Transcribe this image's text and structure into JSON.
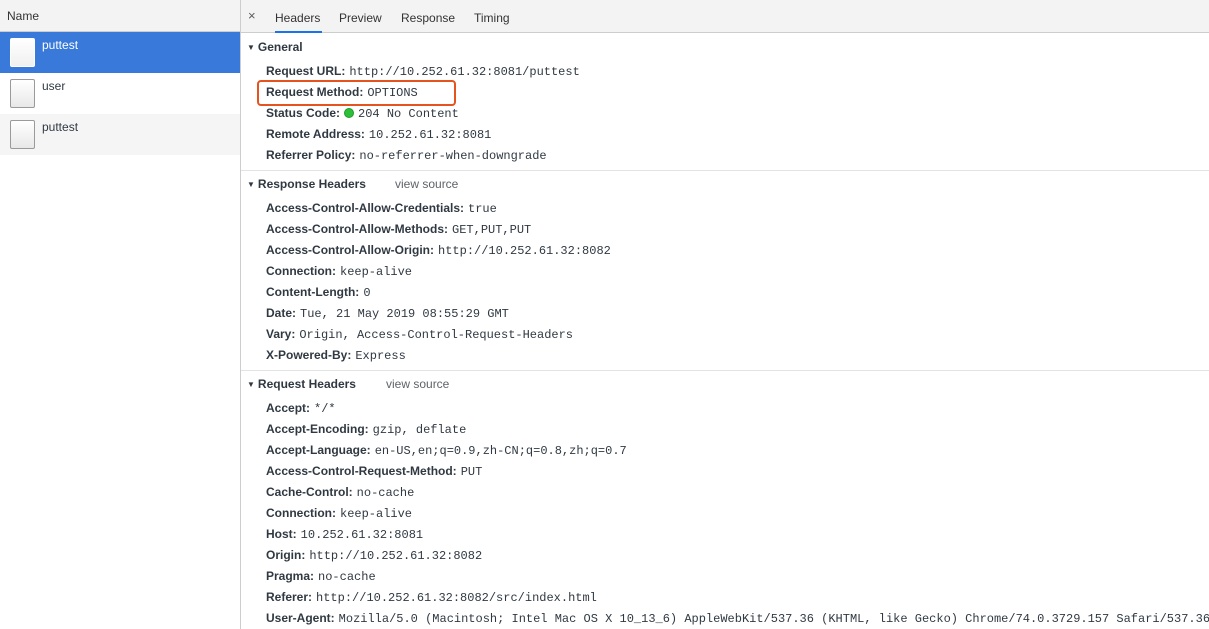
{
  "left_panel": {
    "header": "Name",
    "requests": [
      {
        "name": "puttest"
      },
      {
        "name": "user"
      },
      {
        "name": "puttest"
      }
    ]
  },
  "tabs": {
    "close": "×",
    "items": [
      "Headers",
      "Preview",
      "Response",
      "Timing"
    ],
    "active": "Headers"
  },
  "general": {
    "title": "General",
    "rows": [
      {
        "key": "Request URL:",
        "value": "http://10.252.61.32:8081/puttest"
      },
      {
        "key": "Request Method:",
        "value": "OPTIONS"
      },
      {
        "key": "Status Code:",
        "value": "204 No Content"
      },
      {
        "key": "Remote Address:",
        "value": "10.252.61.32:8081"
      },
      {
        "key": "Referrer Policy:",
        "value": "no-referrer-when-downgrade"
      }
    ]
  },
  "response_headers": {
    "title": "Response Headers",
    "view_source": "view source",
    "rows": [
      {
        "key": "Access-Control-Allow-Credentials:",
        "value": "true"
      },
      {
        "key": "Access-Control-Allow-Methods:",
        "value": "GET,PUT,PUT"
      },
      {
        "key": "Access-Control-Allow-Origin:",
        "value": "http://10.252.61.32:8082"
      },
      {
        "key": "Connection:",
        "value": "keep-alive"
      },
      {
        "key": "Content-Length:",
        "value": "0"
      },
      {
        "key": "Date:",
        "value": "Tue, 21 May 2019 08:55:29 GMT"
      },
      {
        "key": "Vary:",
        "value": "Origin, Access-Control-Request-Headers"
      },
      {
        "key": "X-Powered-By:",
        "value": "Express"
      }
    ]
  },
  "request_headers": {
    "title": "Request Headers",
    "view_source": "view source",
    "rows": [
      {
        "key": "Accept:",
        "value": "*/*"
      },
      {
        "key": "Accept-Encoding:",
        "value": "gzip, deflate"
      },
      {
        "key": "Accept-Language:",
        "value": "en-US,en;q=0.9,zh-CN;q=0.8,zh;q=0.7"
      },
      {
        "key": "Access-Control-Request-Method:",
        "value": "PUT"
      },
      {
        "key": "Cache-Control:",
        "value": "no-cache"
      },
      {
        "key": "Connection:",
        "value": "keep-alive"
      },
      {
        "key": "Host:",
        "value": "10.252.61.32:8081"
      },
      {
        "key": "Origin:",
        "value": "http://10.252.61.32:8082"
      },
      {
        "key": "Pragma:",
        "value": "no-cache"
      },
      {
        "key": "Referer:",
        "value": "http://10.252.61.32:8082/src/index.html"
      },
      {
        "key": "User-Agent:",
        "value": "Mozilla/5.0 (Macintosh; Intel Mac OS X 10_13_6) AppleWebKit/537.36 (KHTML, like Gecko) Chrome/74.0.3729.157 Safari/537.36"
      }
    ]
  },
  "colors": {
    "selected_row": "#3879d9",
    "highlight_box": "#e5541e",
    "status_ok": "#2dbe3a"
  },
  "icons": {
    "status": "green-status-dot-icon",
    "file": "document-file-icon",
    "collapse": "triangle-down-icon",
    "close": "close-icon"
  }
}
